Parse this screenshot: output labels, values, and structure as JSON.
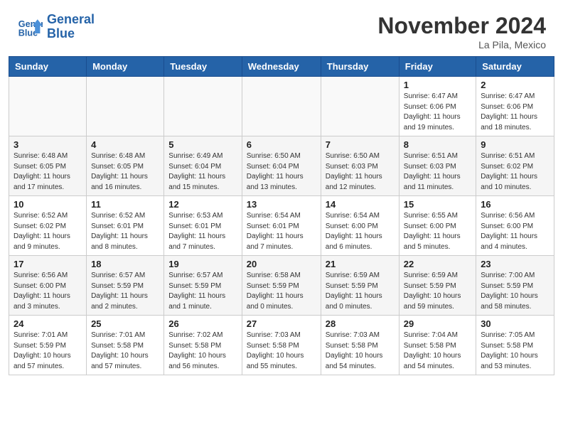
{
  "header": {
    "logo_line1": "General",
    "logo_line2": "Blue",
    "month": "November 2024",
    "location": "La Pila, Mexico"
  },
  "weekdays": [
    "Sunday",
    "Monday",
    "Tuesday",
    "Wednesday",
    "Thursday",
    "Friday",
    "Saturday"
  ],
  "weeks": [
    [
      {
        "day": "",
        "info": ""
      },
      {
        "day": "",
        "info": ""
      },
      {
        "day": "",
        "info": ""
      },
      {
        "day": "",
        "info": ""
      },
      {
        "day": "",
        "info": ""
      },
      {
        "day": "1",
        "info": "Sunrise: 6:47 AM\nSunset: 6:06 PM\nDaylight: 11 hours and 19 minutes."
      },
      {
        "day": "2",
        "info": "Sunrise: 6:47 AM\nSunset: 6:06 PM\nDaylight: 11 hours and 18 minutes."
      }
    ],
    [
      {
        "day": "3",
        "info": "Sunrise: 6:48 AM\nSunset: 6:05 PM\nDaylight: 11 hours and 17 minutes."
      },
      {
        "day": "4",
        "info": "Sunrise: 6:48 AM\nSunset: 6:05 PM\nDaylight: 11 hours and 16 minutes."
      },
      {
        "day": "5",
        "info": "Sunrise: 6:49 AM\nSunset: 6:04 PM\nDaylight: 11 hours and 15 minutes."
      },
      {
        "day": "6",
        "info": "Sunrise: 6:50 AM\nSunset: 6:04 PM\nDaylight: 11 hours and 13 minutes."
      },
      {
        "day": "7",
        "info": "Sunrise: 6:50 AM\nSunset: 6:03 PM\nDaylight: 11 hours and 12 minutes."
      },
      {
        "day": "8",
        "info": "Sunrise: 6:51 AM\nSunset: 6:03 PM\nDaylight: 11 hours and 11 minutes."
      },
      {
        "day": "9",
        "info": "Sunrise: 6:51 AM\nSunset: 6:02 PM\nDaylight: 11 hours and 10 minutes."
      }
    ],
    [
      {
        "day": "10",
        "info": "Sunrise: 6:52 AM\nSunset: 6:02 PM\nDaylight: 11 hours and 9 minutes."
      },
      {
        "day": "11",
        "info": "Sunrise: 6:52 AM\nSunset: 6:01 PM\nDaylight: 11 hours and 8 minutes."
      },
      {
        "day": "12",
        "info": "Sunrise: 6:53 AM\nSunset: 6:01 PM\nDaylight: 11 hours and 7 minutes."
      },
      {
        "day": "13",
        "info": "Sunrise: 6:54 AM\nSunset: 6:01 PM\nDaylight: 11 hours and 7 minutes."
      },
      {
        "day": "14",
        "info": "Sunrise: 6:54 AM\nSunset: 6:00 PM\nDaylight: 11 hours and 6 minutes."
      },
      {
        "day": "15",
        "info": "Sunrise: 6:55 AM\nSunset: 6:00 PM\nDaylight: 11 hours and 5 minutes."
      },
      {
        "day": "16",
        "info": "Sunrise: 6:56 AM\nSunset: 6:00 PM\nDaylight: 11 hours and 4 minutes."
      }
    ],
    [
      {
        "day": "17",
        "info": "Sunrise: 6:56 AM\nSunset: 6:00 PM\nDaylight: 11 hours and 3 minutes."
      },
      {
        "day": "18",
        "info": "Sunrise: 6:57 AM\nSunset: 5:59 PM\nDaylight: 11 hours and 2 minutes."
      },
      {
        "day": "19",
        "info": "Sunrise: 6:57 AM\nSunset: 5:59 PM\nDaylight: 11 hours and 1 minute."
      },
      {
        "day": "20",
        "info": "Sunrise: 6:58 AM\nSunset: 5:59 PM\nDaylight: 11 hours and 0 minutes."
      },
      {
        "day": "21",
        "info": "Sunrise: 6:59 AM\nSunset: 5:59 PM\nDaylight: 11 hours and 0 minutes."
      },
      {
        "day": "22",
        "info": "Sunrise: 6:59 AM\nSunset: 5:59 PM\nDaylight: 10 hours and 59 minutes."
      },
      {
        "day": "23",
        "info": "Sunrise: 7:00 AM\nSunset: 5:59 PM\nDaylight: 10 hours and 58 minutes."
      }
    ],
    [
      {
        "day": "24",
        "info": "Sunrise: 7:01 AM\nSunset: 5:59 PM\nDaylight: 10 hours and 57 minutes."
      },
      {
        "day": "25",
        "info": "Sunrise: 7:01 AM\nSunset: 5:58 PM\nDaylight: 10 hours and 57 minutes."
      },
      {
        "day": "26",
        "info": "Sunrise: 7:02 AM\nSunset: 5:58 PM\nDaylight: 10 hours and 56 minutes."
      },
      {
        "day": "27",
        "info": "Sunrise: 7:03 AM\nSunset: 5:58 PM\nDaylight: 10 hours and 55 minutes."
      },
      {
        "day": "28",
        "info": "Sunrise: 7:03 AM\nSunset: 5:58 PM\nDaylight: 10 hours and 54 minutes."
      },
      {
        "day": "29",
        "info": "Sunrise: 7:04 AM\nSunset: 5:58 PM\nDaylight: 10 hours and 54 minutes."
      },
      {
        "day": "30",
        "info": "Sunrise: 7:05 AM\nSunset: 5:58 PM\nDaylight: 10 hours and 53 minutes."
      }
    ]
  ]
}
